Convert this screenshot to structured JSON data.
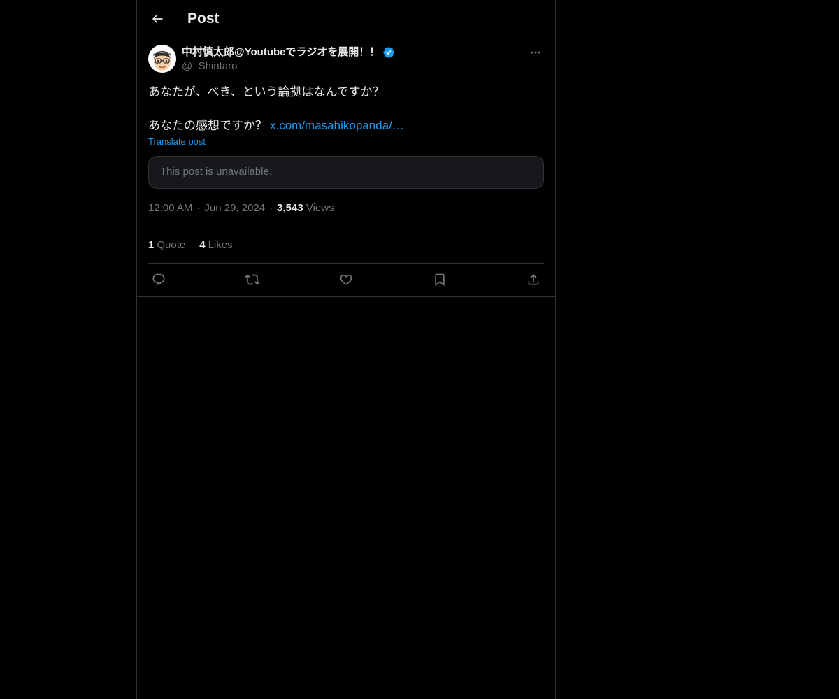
{
  "header": {
    "title": "Post",
    "back_icon": "arrow-left-icon"
  },
  "post": {
    "author": {
      "display_name": "中村慎太郎@Youtubeでラジオを展開！！",
      "handle": "@_Shintaro_",
      "verified": true,
      "avatar_icon": "cartoon-face-avatar"
    },
    "text_line_1": "あなたが、べき、という論拠はなんですか？",
    "text_line_2": "あなたの感想ですか？",
    "link_text": "x.com/masahikopanda/…",
    "translate_label": "Translate post",
    "quote_unavailable": "This post is unavailable.",
    "time": "12:00 AM",
    "date": "Jun 29, 2024",
    "views_count": "3,543",
    "views_label": "Views",
    "quote_count": "1",
    "quote_label": "Quote",
    "likes_count": "4",
    "likes_label": "Likes"
  },
  "actions": [
    "reply-icon",
    "repost-icon",
    "like-icon",
    "bookmark-icon",
    "share-icon"
  ],
  "colors": {
    "background": "#000000",
    "text": "#e7e9ea",
    "secondary": "#71767b",
    "accent": "#1d9bf0",
    "border": "#2f3336"
  }
}
